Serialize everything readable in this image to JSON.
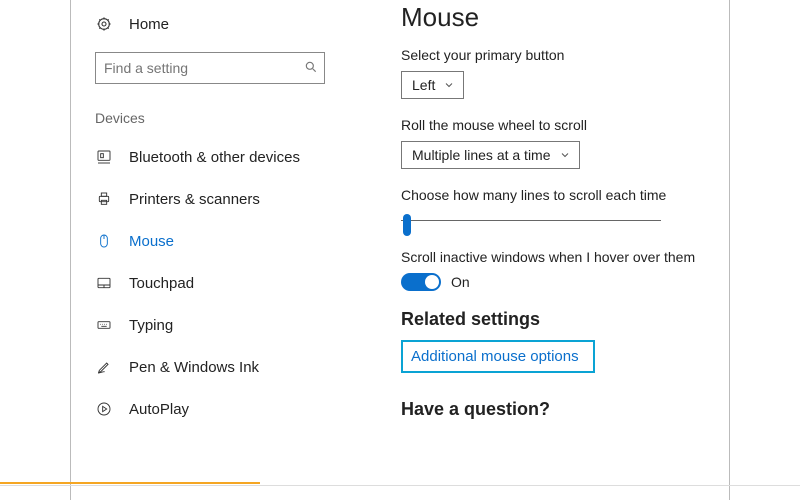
{
  "sidebar": {
    "home_label": "Home",
    "search_placeholder": "Find a setting",
    "group_title": "Devices",
    "items": [
      {
        "label": "Bluetooth & other devices"
      },
      {
        "label": "Printers & scanners"
      },
      {
        "label": "Mouse"
      },
      {
        "label": "Touchpad"
      },
      {
        "label": "Typing"
      },
      {
        "label": "Pen & Windows Ink"
      },
      {
        "label": "AutoPlay"
      }
    ]
  },
  "main": {
    "title": "Mouse",
    "primary": {
      "label": "Select your primary button",
      "value": "Left"
    },
    "roll": {
      "label": "Roll the mouse wheel to scroll",
      "value": "Multiple lines at a time"
    },
    "lines_label": "Choose how many lines to scroll each time",
    "inactive": {
      "label": "Scroll inactive windows when I hover over them",
      "state": "On"
    },
    "related_title": "Related settings",
    "link_text": "Additional mouse options",
    "question_title": "Have a question?"
  }
}
